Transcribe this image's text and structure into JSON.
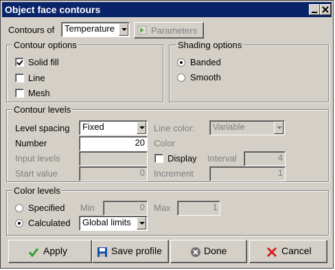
{
  "window": {
    "title": "Object face contours"
  },
  "contours_of": {
    "label": "Contours of",
    "value": "Temperature",
    "parameters_label": "Parameters"
  },
  "contour_options": {
    "title": "Contour options",
    "solid_fill": {
      "label": "Solid fill",
      "checked": true
    },
    "line": {
      "label": "Line",
      "checked": false
    },
    "mesh": {
      "label": "Mesh",
      "checked": false
    }
  },
  "shading_options": {
    "title": "Shading options",
    "banded": {
      "label": "Banded",
      "selected": true
    },
    "smooth": {
      "label": "Smooth",
      "selected": false
    }
  },
  "contour_levels": {
    "title": "Contour levels",
    "level_spacing_label": "Level spacing",
    "level_spacing_value": "Fixed",
    "line_color_label": "Line color:",
    "line_color_value": "Variable",
    "number_label": "Number",
    "number_value": "20",
    "color_label": "Color",
    "input_levels_label": "Input levels",
    "input_levels_value": "",
    "display_label": "Display",
    "interval_label": "Interval",
    "interval_value": "4",
    "start_value_label": "Start value",
    "start_value_value": "0",
    "increment_label": "Increment",
    "increment_value": "1"
  },
  "color_levels": {
    "title": "Color levels",
    "specified_label": "Specified",
    "min_label": "Min",
    "min_value": "0",
    "max_label": "Max",
    "max_value": "1",
    "calculated_label": "Calculated",
    "calculated_value": "Global limits"
  },
  "buttons": {
    "apply": "Apply",
    "save_profile": "Save profile",
    "done": "Done",
    "cancel": "Cancel"
  }
}
